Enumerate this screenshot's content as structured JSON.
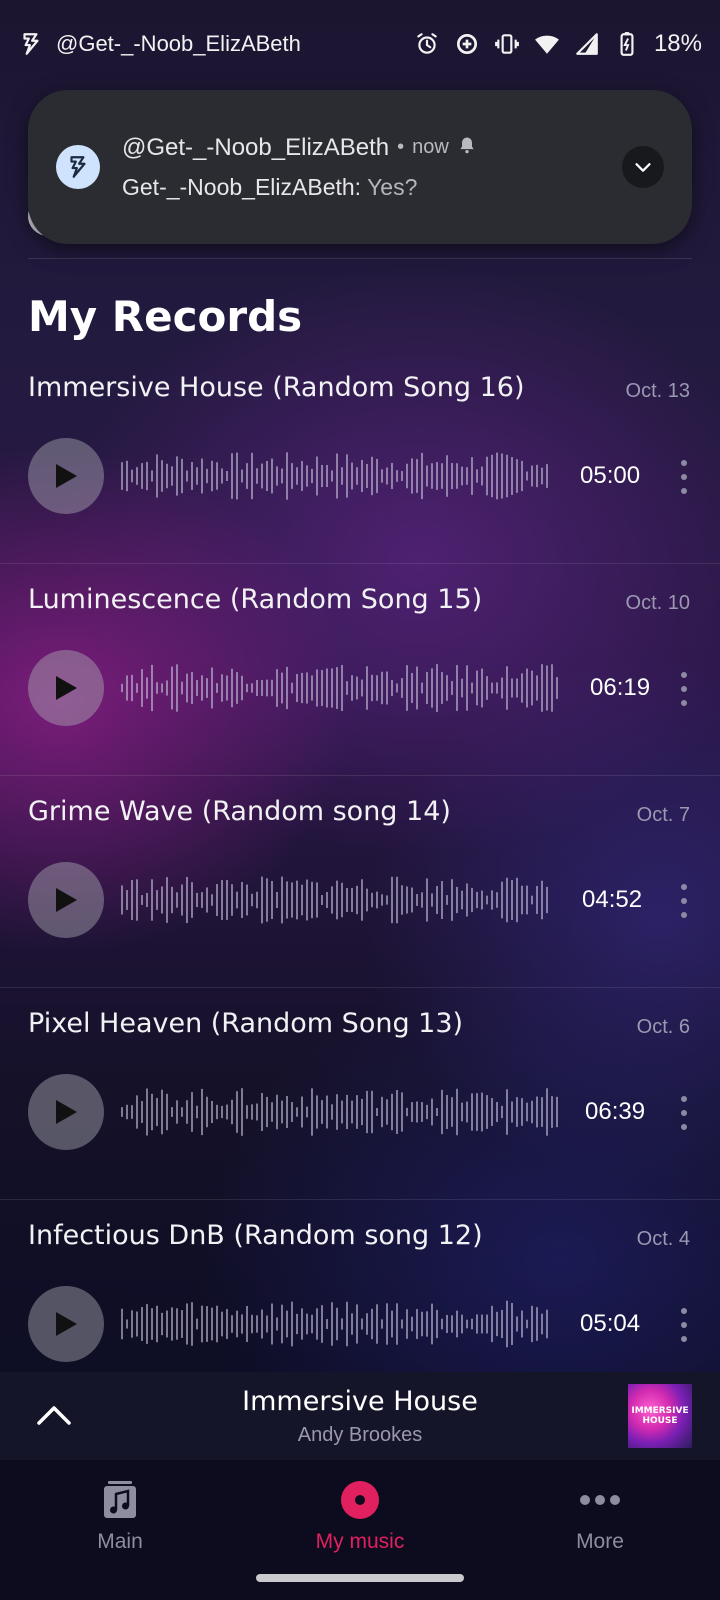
{
  "status_bar": {
    "app_name": "@Get-_-Noob_ElizABeth",
    "battery": "18%",
    "icons": [
      "bolt-app-icon",
      "alarm-icon",
      "data-saver-icon",
      "vibrate-icon",
      "wifi-icon",
      "signal-icon",
      "battery-charging-icon"
    ]
  },
  "notification": {
    "app": "@Get-_-Noob_ElizABeth",
    "separator": "•",
    "time": "now",
    "sender": "Get-_-Noob_ElizABeth:",
    "message": "Yes?"
  },
  "page": {
    "title": "My Records"
  },
  "records": [
    {
      "title": "Immersive House (Random Song 16)",
      "date": "Oct. 13",
      "duration": "05:00"
    },
    {
      "title": "Luminescence (Random Song 15)",
      "date": "Oct. 10",
      "duration": "06:19"
    },
    {
      "title": "Grime Wave (Random song 14)",
      "date": "Oct. 7",
      "duration": "04:52"
    },
    {
      "title": "Pixel Heaven (Random Song 13)",
      "date": "Oct. 6",
      "duration": "06:39"
    },
    {
      "title": "Infectious DnB (Random song 12)",
      "date": "Oct. 4",
      "duration": "05:04"
    }
  ],
  "mini_player": {
    "title": "Immersive House",
    "artist": "Andy Brookes",
    "art_text": "IMMERSIVE HOUSE"
  },
  "nav": {
    "items": [
      {
        "label": "Main",
        "icon": "music-note-icon"
      },
      {
        "label": "My music",
        "icon": "record-icon",
        "active": true
      },
      {
        "label": "More",
        "icon": "more-dots-icon"
      }
    ]
  },
  "colors": {
    "accent": "#e0205f",
    "notification_bg": "#2b2c31"
  }
}
